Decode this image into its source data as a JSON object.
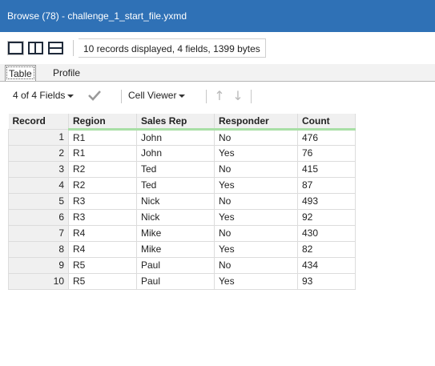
{
  "window": {
    "title": "Browse (78) - challenge_1_start_file.yxmd"
  },
  "toolbar": {
    "layout_buttons": [
      "single-pane-icon",
      "split-columns-icon",
      "split-rows-icon"
    ],
    "status": "10 records displayed, 4 fields, 1399 bytes"
  },
  "tabs": [
    {
      "label": "Table",
      "active": true
    },
    {
      "label": "Profile",
      "active": false
    }
  ],
  "fieldbar": {
    "fields_label": "4 of 4 Fields",
    "cell_viewer_label": "Cell Viewer",
    "icons": [
      "checkmark-icon",
      "arrow-up-icon",
      "arrow-down-icon"
    ]
  },
  "table": {
    "columns": [
      "Record",
      "Region",
      "Sales Rep",
      "Responder",
      "Count"
    ],
    "rows": [
      [
        "1",
        "R1",
        "John",
        "No",
        "476"
      ],
      [
        "2",
        "R1",
        "John",
        "Yes",
        "76"
      ],
      [
        "3",
        "R2",
        "Ted",
        "No",
        "415"
      ],
      [
        "4",
        "R2",
        "Ted",
        "Yes",
        "87"
      ],
      [
        "5",
        "R3",
        "Nick",
        "No",
        "493"
      ],
      [
        "6",
        "R3",
        "Nick",
        "Yes",
        "92"
      ],
      [
        "7",
        "R4",
        "Mike",
        "No",
        "430"
      ],
      [
        "8",
        "R4",
        "Mike",
        "Yes",
        "82"
      ],
      [
        "9",
        "R5",
        "Paul",
        "No",
        "434"
      ],
      [
        "10",
        "R5",
        "Paul",
        "Yes",
        "93"
      ]
    ]
  },
  "colors": {
    "titlebar": "#2f71b6",
    "header_underline": "#a9dfa6",
    "header_bg": "#f0f0f0"
  }
}
